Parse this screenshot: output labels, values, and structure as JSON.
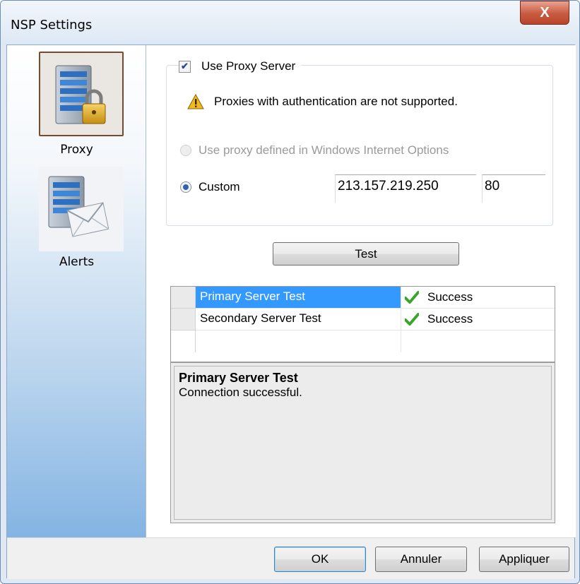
{
  "window": {
    "title": "NSP Settings",
    "close_label": "X"
  },
  "sidebar": {
    "items": [
      {
        "label": "Proxy",
        "icon": "server-lock-icon",
        "selected": true
      },
      {
        "label": "Alerts",
        "icon": "server-mail-icon",
        "selected": false
      }
    ]
  },
  "proxy": {
    "use_proxy_label": "Use Proxy Server",
    "use_proxy_checked": true,
    "warning": "Proxies with authentication are not supported.",
    "option_windows_label": "Use proxy defined in Windows Internet Options",
    "option_custom_label": "Custom",
    "selected_option": "custom",
    "host": "213.157.219.250",
    "port": "80",
    "test_label": "Test"
  },
  "results": {
    "rows": [
      {
        "name": "Primary Server Test",
        "status": "Success",
        "selected": true
      },
      {
        "name": "Secondary Server Test",
        "status": "Success",
        "selected": false
      }
    ],
    "detail_title": "Primary Server Test",
    "detail_text": "Connection successful."
  },
  "footer": {
    "ok": "OK",
    "cancel": "Annuler",
    "apply": "Appliquer"
  },
  "colors": {
    "accent": "#3399ff",
    "success": "#3aa52a",
    "warning": "#e8a317"
  }
}
